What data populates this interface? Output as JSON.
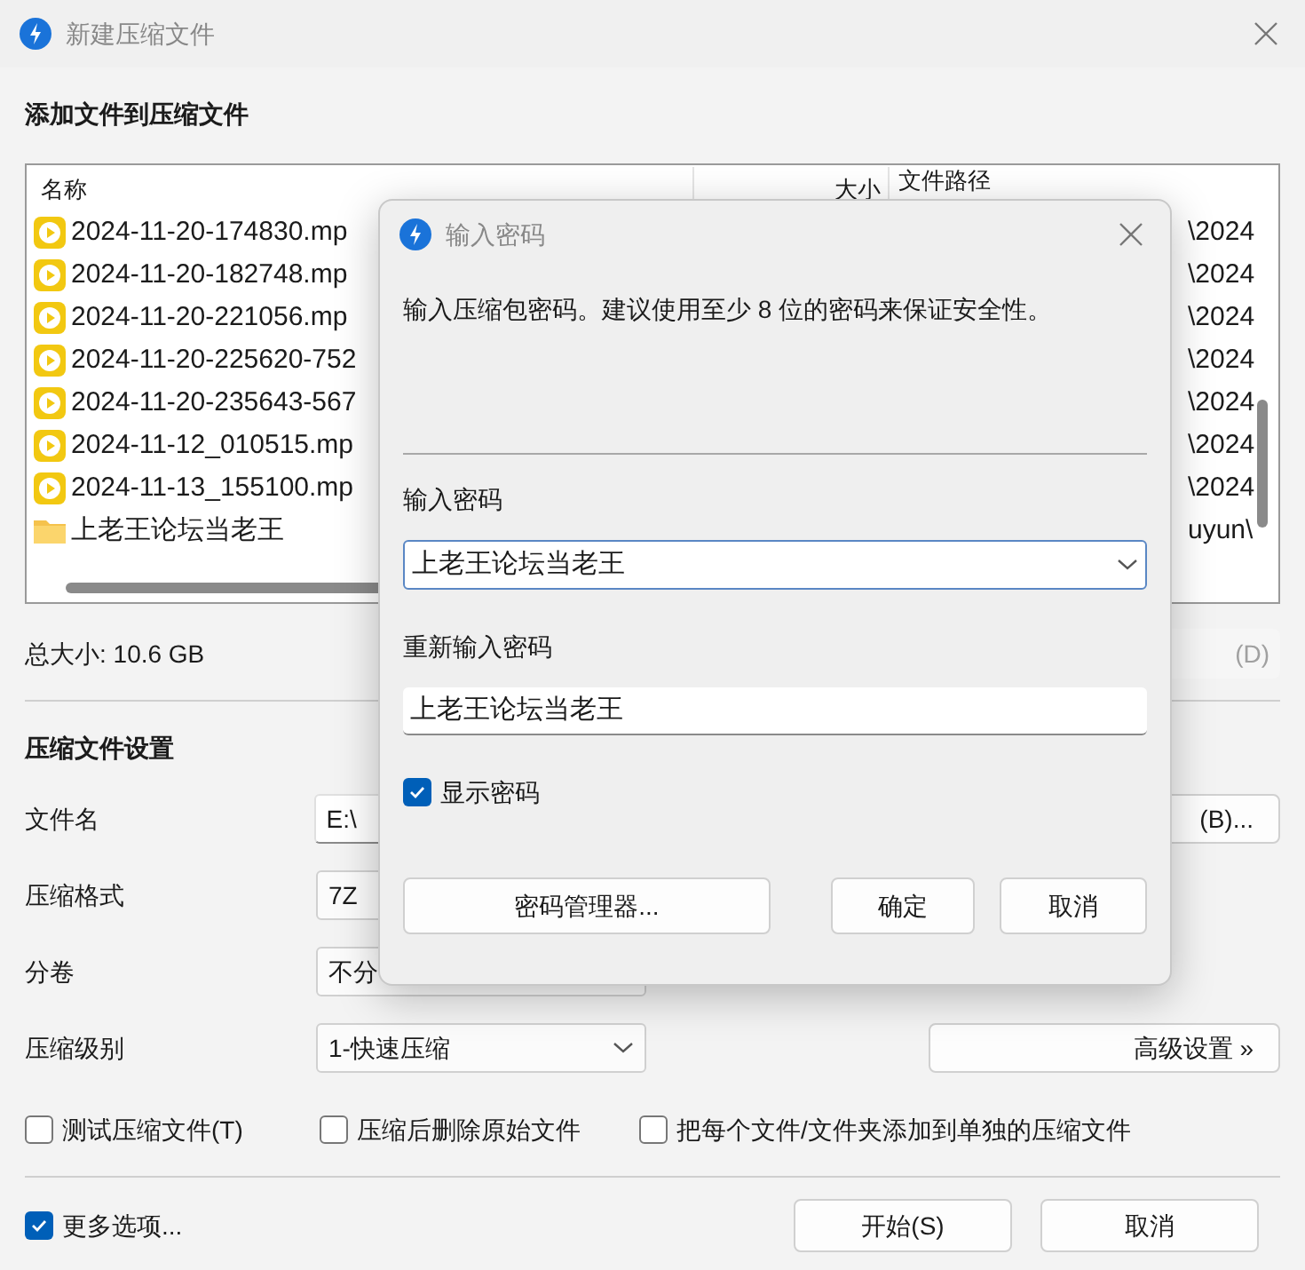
{
  "window": {
    "title": "新建压缩文件"
  },
  "files_section": {
    "heading": "添加文件到压缩文件"
  },
  "file_list": {
    "columns": [
      "名称",
      "大小",
      "文件路径"
    ],
    "rows": [
      {
        "kind": "video",
        "name": "2024-11-20-174830.mp",
        "path": "\\2024"
      },
      {
        "kind": "video",
        "name": "2024-11-20-182748.mp",
        "path": "\\2024"
      },
      {
        "kind": "video",
        "name": "2024-11-20-221056.mp",
        "path": "\\2024"
      },
      {
        "kind": "video",
        "name": "2024-11-20-225620-752",
        "path": "\\2024"
      },
      {
        "kind": "video",
        "name": "2024-11-20-235643-567",
        "path": "\\2024"
      },
      {
        "kind": "video",
        "name": "2024-11-12_010515.mp",
        "path": "\\2024"
      },
      {
        "kind": "video",
        "name": "2024-11-13_155100.mp",
        "path": "\\2024"
      },
      {
        "kind": "folder",
        "name": "上老王论坛当老王",
        "path": "uyun\\"
      }
    ]
  },
  "total_size": "总大小: 10.6 GB",
  "remove_button": {
    "label": "(D)",
    "disabled": true
  },
  "settings": {
    "heading": "压缩文件设置",
    "fields": [
      {
        "kind": "text",
        "label": "文件名",
        "value": "E:\\",
        "button": "(B)..."
      },
      {
        "kind": "select",
        "label": "压缩格式",
        "value": "7Z"
      },
      {
        "kind": "select",
        "label": "分卷",
        "value": "不分"
      },
      {
        "kind": "select",
        "label": "压缩级别",
        "value": "1-快速压缩",
        "caret": true,
        "button": "高级设置 »"
      }
    ]
  },
  "options": [
    {
      "label": "测试压缩文件(T)",
      "checked": false
    },
    {
      "label": "压缩后删除原始文件",
      "checked": false
    },
    {
      "label": "把每个文件/文件夹添加到单独的压缩文件",
      "checked": false
    }
  ],
  "more_options": {
    "label": "更多选项...",
    "checked": true
  },
  "buttons": [
    "开始(S)",
    "取消"
  ],
  "password_dialog": {
    "title": "输入密码",
    "description": "输入压缩包密码。建议使用至少 8 位的密码来保证安全性。",
    "password_label": "输入密码",
    "password_value": "上老王论坛当老王",
    "confirm_label": "重新输入密码",
    "confirm_value": "上老王论坛当老王",
    "show_password": {
      "label": "显示密码",
      "checked": true
    },
    "manager_button": "密码管理器...",
    "buttons": [
      "确定",
      "取消"
    ]
  }
}
